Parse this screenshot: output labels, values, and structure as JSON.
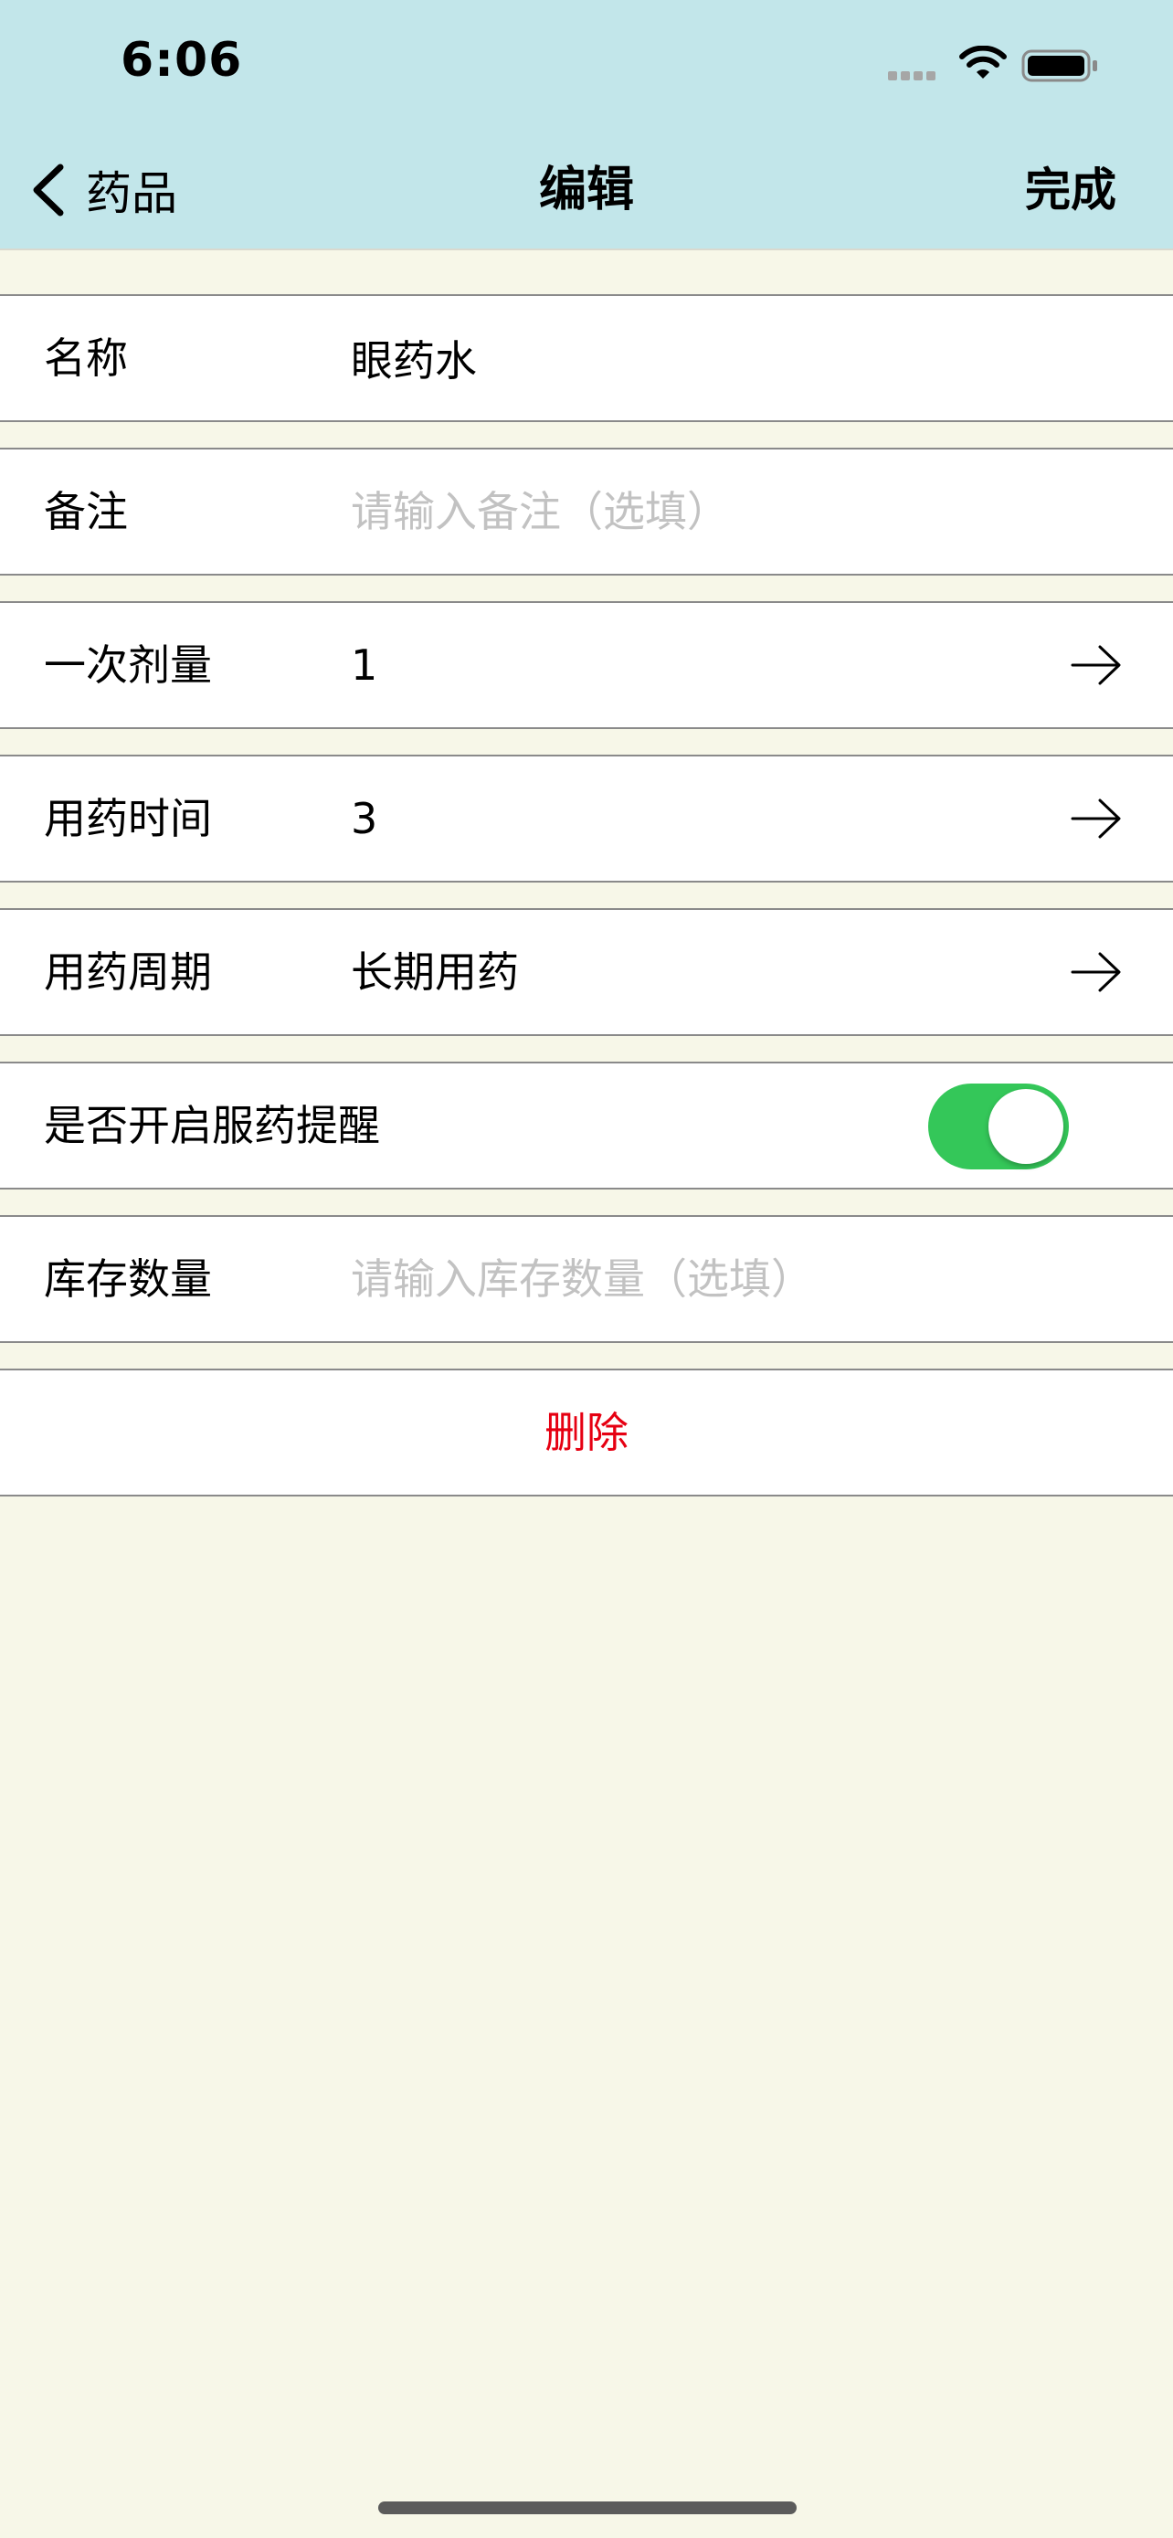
{
  "status_bar": {
    "time": "6:06",
    "icons": [
      "signal-icon",
      "wifi-icon",
      "battery-icon"
    ]
  },
  "nav": {
    "back_label": "药品",
    "title": "编辑",
    "done_label": "完成"
  },
  "form": {
    "name": {
      "label": "名称",
      "value": "眼药水"
    },
    "note": {
      "label": "备注",
      "value": "",
      "placeholder": "请输入备注（选填）"
    },
    "dose": {
      "label": "一次剂量",
      "value": "1"
    },
    "time": {
      "label": "用药时间",
      "value": "3"
    },
    "period": {
      "label": "用药周期",
      "value": "长期用药"
    },
    "reminder": {
      "label": "是否开启服药提醒",
      "enabled": true
    },
    "stock": {
      "label": "库存数量",
      "value": "",
      "placeholder": "请输入库存数量（选填）"
    }
  },
  "delete_label": "删除",
  "colors": {
    "header_bg": "#c2e6ea",
    "page_bg": "#f7f7e8",
    "toggle_on": "#34c759",
    "delete_text": "#e60012",
    "placeholder": "#c2c2c2"
  }
}
